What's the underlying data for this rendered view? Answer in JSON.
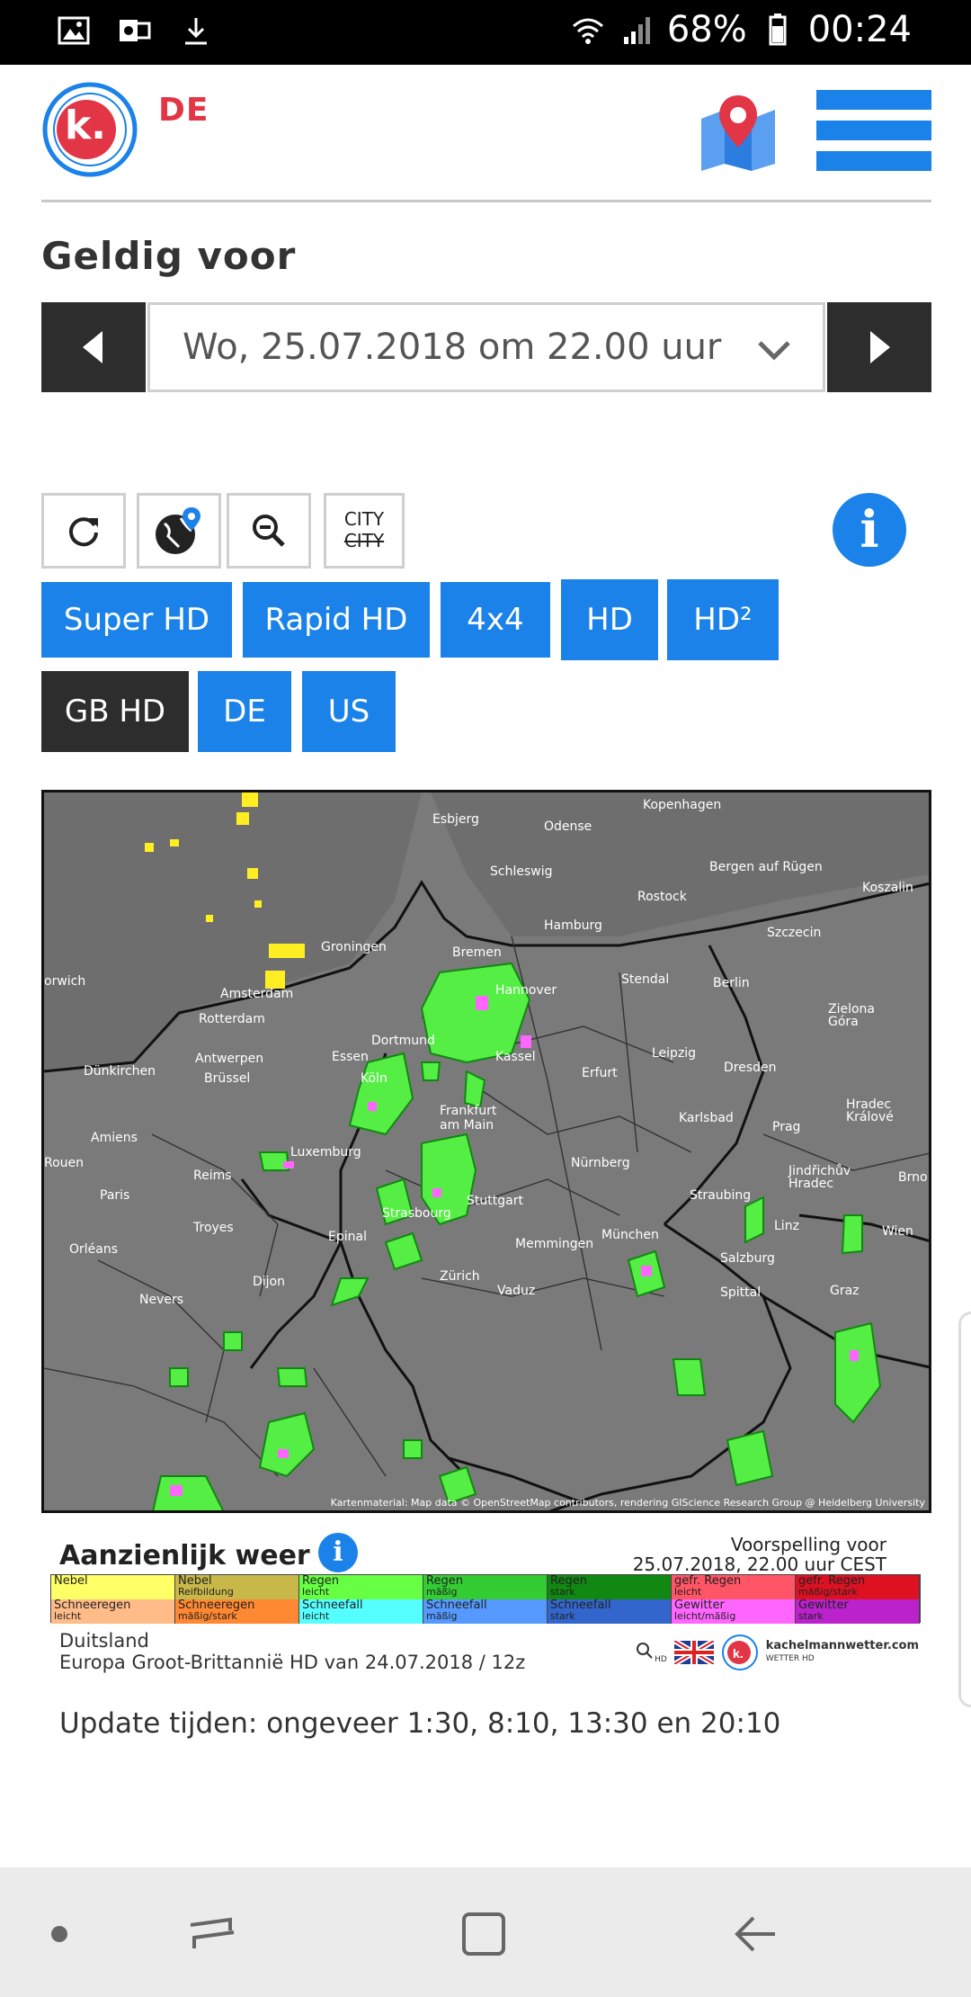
{
  "status_bar": {
    "battery": "68%",
    "time": "00:24",
    "icons": [
      "gallery-icon",
      "outlook-icon",
      "download-icon",
      "wifi-icon",
      "signal-icon",
      "battery-icon"
    ]
  },
  "header": {
    "logo_letter": "k.",
    "country": "DE",
    "accent_color": "#1a82e8",
    "brand_red": "#e23546"
  },
  "valid": {
    "title": "Geldig voor",
    "selected_date": "Wo, 25.07.2018 om 22.00 uur"
  },
  "tools": {
    "city_label": "CITY",
    "city_strike": "CITY"
  },
  "buttons": [
    {
      "label": "Super HD",
      "active": false
    },
    {
      "label": "Rapid HD",
      "active": false
    },
    {
      "label": "4x4",
      "active": false
    },
    {
      "label": "HD",
      "active": false
    },
    {
      "label": "HD²",
      "active": false
    },
    {
      "label": "GB HD",
      "active": true
    },
    {
      "label": "DE",
      "active": false
    },
    {
      "label": "US",
      "active": false
    }
  ],
  "map": {
    "cities": [
      "Kopenhagen",
      "Esbjerg",
      "Odense",
      "Schleswig",
      "Bergen auf Rügen",
      "Rostock",
      "Koszalin",
      "Hamburg",
      "Szczecin",
      "Groningen",
      "Bremen",
      "Amsterdam",
      "Hannover",
      "Stendal",
      "Berlin",
      "Rotterdam",
      "Dortmund",
      "Zielona Góra",
      "Antwerpen",
      "Essen",
      "Leipzig",
      "Dünkirchen",
      "Brüssel",
      "Kassel",
      "Erfurt",
      "Dresden",
      "Köln",
      "Frankfurt am Main",
      "Karlsbad",
      "Prag",
      "Hradec Králové",
      "Amiens",
      "Luxemburg",
      "Nürnberg",
      "Reims",
      "Jindřichův Hradec",
      "Brno",
      "Paris",
      "Stuttgart",
      "Straubing",
      "Strasbourg",
      "Troyes",
      "Epinal",
      "Linz",
      "Wien",
      "Memmingen",
      "München",
      "Orléans",
      "Salzburg",
      "Dijon",
      "Zürich",
      "Vaduz",
      "Spittal",
      "Graz",
      "Nevers",
      "orwich",
      "Rouen"
    ],
    "credit": "Kartenmaterial: Map data © OpenStreetMap contributors, rendering GIScience Research Group @ Heidelberg University"
  },
  "legend": {
    "title": "Aanzienlijk weer",
    "forecast_line1": "Voorspelling voor",
    "forecast_line2": "25.07.2018, 22.00 uur CEST",
    "cells": [
      {
        "label": "Nebel",
        "sub": "",
        "color": "#ffff66"
      },
      {
        "label": "Nebel",
        "sub": "Reifbildung",
        "color": "#c8b84a"
      },
      {
        "label": "Regen",
        "sub": "leicht",
        "color": "#66ff44"
      },
      {
        "label": "Regen",
        "sub": "mäßig",
        "color": "#33cc33"
      },
      {
        "label": "Regen",
        "sub": "stark",
        "color": "#118811"
      },
      {
        "label": "gefr. Regen",
        "sub": "leicht",
        "color": "#ff5566"
      },
      {
        "label": "gefr. Regen",
        "sub": "mäßig/stark",
        "color": "#dd1122"
      },
      {
        "label": "Schneeregen",
        "sub": "leicht",
        "color": "#ffbb88"
      },
      {
        "label": "Schneeregen",
        "sub": "mäßig/stark",
        "color": "#ff8833"
      },
      {
        "label": "Schneefall",
        "sub": "leicht",
        "color": "#55ffff"
      },
      {
        "label": "Schneefall",
        "sub": "mäßig",
        "color": "#5599ff"
      },
      {
        "label": "Schneefall",
        "sub": "stark",
        "color": "#3366cc"
      },
      {
        "label": "Gewitter",
        "sub": "leicht/mäßig",
        "color": "#ff66ff"
      },
      {
        "label": "Gewitter",
        "sub": "stark",
        "color": "#bb22cc"
      }
    ],
    "region_line1": "Duitsland",
    "region_line2": "Europa Groot-Brittannië HD van 24.07.2018 / 12z",
    "brand_name": "kachelmannwetter.com",
    "brand_sub": "WETTER HD",
    "brand_tag": "HD"
  },
  "update_text": "Update tijden: ongeveer 1:30, 8:10, 13:30 en 20:10"
}
